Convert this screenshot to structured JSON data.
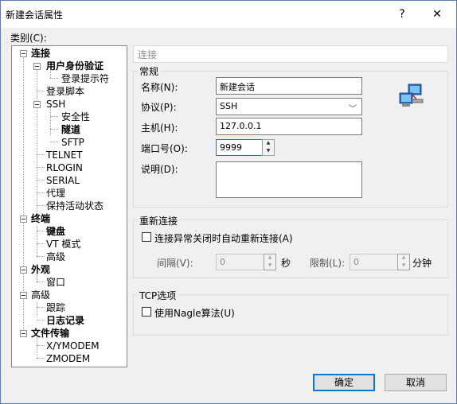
{
  "window": {
    "title": "新建会话属性",
    "help_glyph": "?",
    "close_glyph": "✕"
  },
  "category_label": "类别(C):",
  "tree": [
    {
      "label": "连接",
      "bold": true
    },
    {
      "label": "用户身份验证",
      "bold": true
    },
    {
      "label": "登录提示符",
      "bold": false
    },
    {
      "label": "登录脚本",
      "bold": false
    },
    {
      "label": "SSH",
      "bold": false
    },
    {
      "label": "安全性",
      "bold": false
    },
    {
      "label": "隧道",
      "bold": true
    },
    {
      "label": "SFTP",
      "bold": false
    },
    {
      "label": "TELNET",
      "bold": false
    },
    {
      "label": "RLOGIN",
      "bold": false
    },
    {
      "label": "SERIAL",
      "bold": false
    },
    {
      "label": "代理",
      "bold": false
    },
    {
      "label": "保持活动状态",
      "bold": false
    },
    {
      "label": "终端",
      "bold": true
    },
    {
      "label": "键盘",
      "bold": true
    },
    {
      "label": "VT 模式",
      "bold": false
    },
    {
      "label": "高级",
      "bold": false
    },
    {
      "label": "外观",
      "bold": true
    },
    {
      "label": "窗口",
      "bold": false
    },
    {
      "label": "高级",
      "bold": false
    },
    {
      "label": "跟踪",
      "bold": false
    },
    {
      "label": "日志记录",
      "bold": true
    },
    {
      "label": "文件传输",
      "bold": true
    },
    {
      "label": "X/YMODEM",
      "bold": false
    },
    {
      "label": "ZMODEM",
      "bold": false
    }
  ],
  "section_title": "连接",
  "general": {
    "group_title": "常规",
    "name_label": "名称(N):",
    "name_value": "新建会话",
    "protocol_label": "协议(P):",
    "protocol_value": "SSH",
    "host_label": "主机(H):",
    "host_value": "127.0.0.1",
    "port_label": "端口号(O):",
    "port_value": "9999",
    "desc_label": "说明(D):",
    "desc_value": ""
  },
  "reconnect": {
    "group_title": "重新连接",
    "checkbox_label": "连接异常关闭时自动重新连接(A)",
    "interval_label": "间隔(V):",
    "interval_value": "0",
    "interval_unit": "秒",
    "limit_label": "限制(L):",
    "limit_value": "0",
    "limit_unit": "分钟"
  },
  "tcp": {
    "group_title": "TCP选项",
    "nagle_label": "使用Nagle算法(U)"
  },
  "buttons": {
    "ok": "确定",
    "cancel": "取消"
  },
  "icons": {
    "network": "network-computer-icon"
  }
}
